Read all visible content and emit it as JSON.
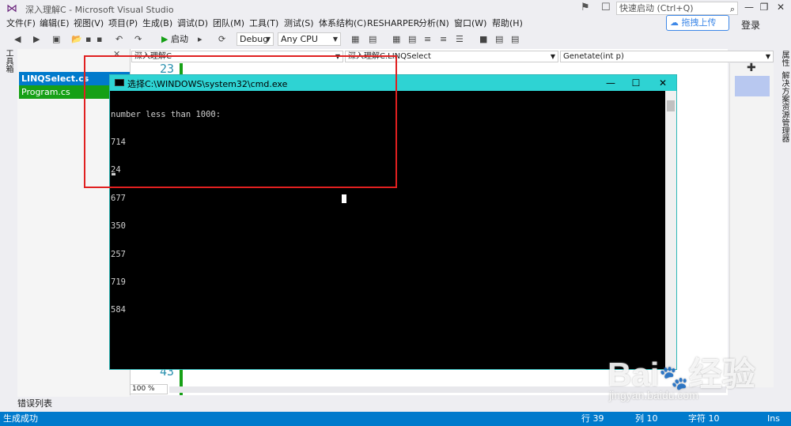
{
  "window": {
    "title": "深入理解C - Microsoft Visual Studio",
    "quick_launch_placeholder": "快速启动 (Ctrl+Q)",
    "minimize": "—",
    "restore": "❐",
    "close": "✕"
  },
  "menu": {
    "items": [
      "文件(F)",
      "编辑(E)",
      "视图(V)",
      "项目(P)",
      "生成(B)",
      "调试(D)",
      "团队(M)",
      "工具(T)",
      "测试(S)",
      "体系结构(C)",
      "RESHARPER",
      "分析(N)",
      "窗口(W)",
      "帮助(H)"
    ],
    "upload_label": "拖拽上传",
    "login_label": "登录"
  },
  "toolbar": {
    "start_label": "启动",
    "config_value": "Debug",
    "platform_value": "Any CPU"
  },
  "left": {
    "toolbox_label": "工具箱",
    "files": [
      "LINQSelect.cs",
      "Program.cs"
    ]
  },
  "editor": {
    "project_combo": "深入理解C",
    "class_combo": "深入理解C.LINQSelect",
    "member_combo": "Genetate(int p)",
    "line_top": "23",
    "line_bottom": "43",
    "zoom": "100 %"
  },
  "right": {
    "tabs": [
      "属性",
      "解决方案资源管理器"
    ]
  },
  "bottom": {
    "error_list_tab": "错误列表"
  },
  "status": {
    "message": "生成成功",
    "line": "行 39",
    "col": "列 10",
    "char": "字符 10",
    "mode": "Ins"
  },
  "console": {
    "title": "选择C:\\WINDOWS\\system32\\cmd.exe",
    "lines": [
      "number less than 1000:",
      "714",
      "24",
      "677",
      "350",
      "257",
      "719",
      "584"
    ]
  },
  "watermark": {
    "logo": "Bai度经验",
    "url": "jingyan.baidu.com"
  },
  "colors": {
    "accent": "#007acc",
    "console_title": "#2ed3d3",
    "highlight": "#e02020",
    "selected_file": "#16a016"
  }
}
